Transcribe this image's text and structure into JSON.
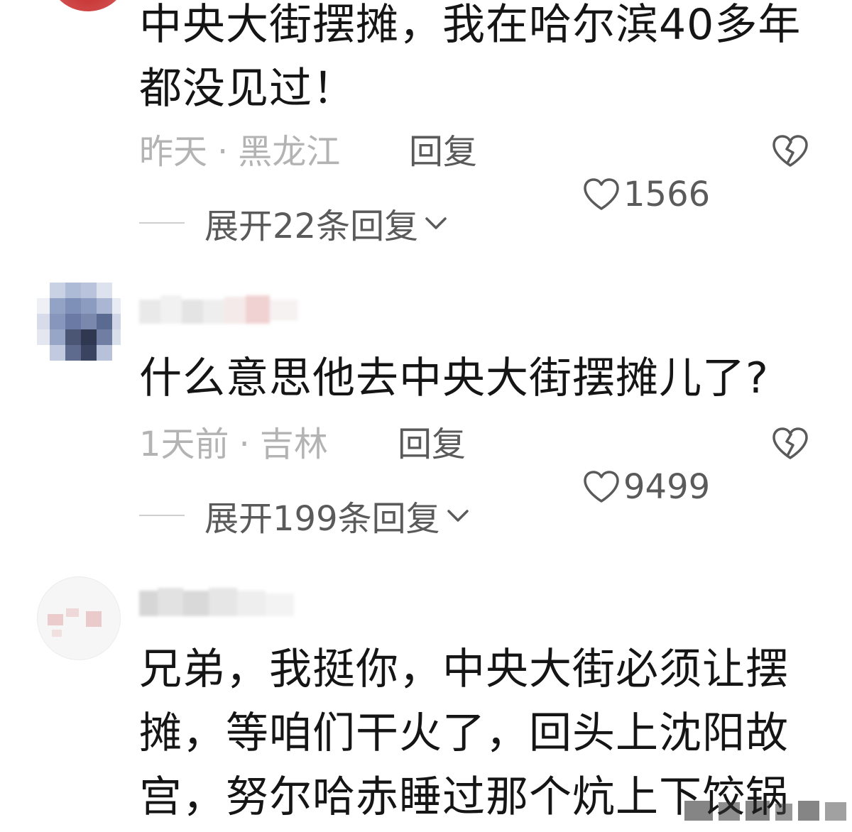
{
  "comments": [
    {
      "text": "中央大街摆摊，我在哈尔滨40多年都没见过！",
      "time": "昨天",
      "location": "黑龙江",
      "reply_label": "回复",
      "likes": "1566",
      "expand_label": "展开22条回复"
    },
    {
      "text": "什么意思他去中央大街摆摊儿了?",
      "time": "1天前",
      "location": "吉林",
      "reply_label": "回复",
      "likes": "9499",
      "expand_label": "展开199条回复"
    },
    {
      "text": "兄弟，我挺你，中央大街必须让摆摊，等咱们干火了，回头上沈阳故宫，努尔哈赤睡过那个炕上下饺锅",
      "blurred_username": "黑白上"
    }
  ],
  "colors": {
    "text": "#151515",
    "meta_gray": "#b3b3b3",
    "action_gray": "#5a5a5a",
    "background": "#ffffff"
  },
  "icons": [
    "heart-icon",
    "broken-heart-icon",
    "chevron-down-icon"
  ]
}
